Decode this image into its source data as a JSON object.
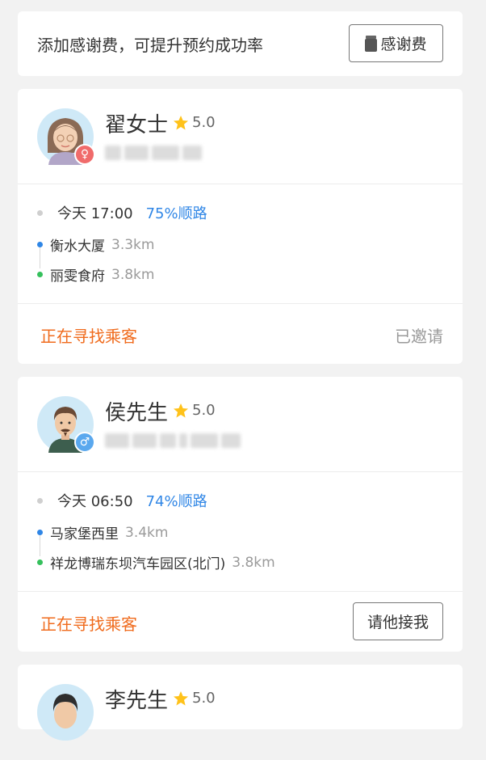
{
  "tip": {
    "text": "添加感谢费，可提升预约成功率",
    "button_label": "感谢费",
    "button_icon": "jar-icon"
  },
  "riders": [
    {
      "name": "翟女士",
      "rating": "5.0",
      "gender_symbol": "♀",
      "gender_color": "#f06b6b",
      "time": "今天 17:00",
      "match": "75%顺路",
      "start": {
        "name": "衡水大厦",
        "distance": "3.3km"
      },
      "end": {
        "name": "丽雯食府",
        "distance": "3.8km"
      },
      "status": "正在寻找乘客",
      "action": "已邀请"
    },
    {
      "name": "侯先生",
      "rating": "5.0",
      "gender_symbol": "♂",
      "gender_color": "#5aa8ee",
      "time": "今天 06:50",
      "match": "74%顺路",
      "start": {
        "name": "马家堡西里",
        "distance": "3.4km"
      },
      "end": {
        "name": "祥龙博瑞东坝汽车园区(北门)",
        "distance": "3.8km"
      },
      "status": "正在寻找乘客",
      "action": "请他接我"
    },
    {
      "name": "李先生",
      "rating": "5.0"
    }
  ],
  "colors": {
    "accent_orange": "#f06b1d",
    "accent_blue": "#2f86e6",
    "star": "#ffc21a"
  }
}
